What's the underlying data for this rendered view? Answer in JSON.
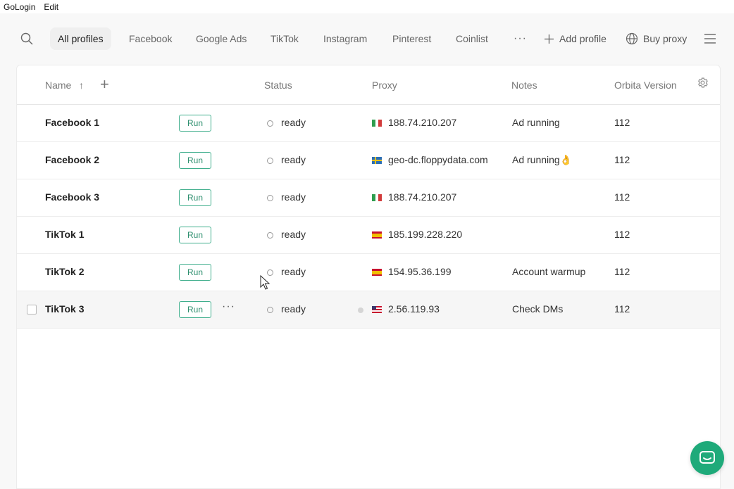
{
  "menubar": {
    "app": "GoLogin",
    "edit": "Edit"
  },
  "tabs": [
    {
      "label": "All profiles"
    },
    {
      "label": "Facebook"
    },
    {
      "label": "Google Ads"
    },
    {
      "label": "TikTok"
    },
    {
      "label": "Instagram"
    },
    {
      "label": "Pinterest"
    },
    {
      "label": "Coinlist"
    }
  ],
  "actions": {
    "more": "···",
    "add_profile": "Add profile",
    "buy_proxy": "Buy proxy"
  },
  "table": {
    "columns": {
      "name": "Name",
      "sort_arrow": "↑",
      "add": "+",
      "status": "Status",
      "proxy": "Proxy",
      "notes": "Notes",
      "version": "Orbita Version"
    },
    "run_label": "Run",
    "row_more": "···",
    "rows": [
      {
        "name": "Facebook 1",
        "status": "ready",
        "proxy": "188.74.210.207",
        "flag": "it",
        "notes": "Ad running",
        "version": "112"
      },
      {
        "name": "Facebook 2",
        "status": "ready",
        "proxy": "geo-dc.floppydata.com",
        "flag": "se",
        "notes": "Ad running👌",
        "version": "112"
      },
      {
        "name": "Facebook 3",
        "status": "ready",
        "proxy": "188.74.210.207",
        "flag": "it",
        "notes": "",
        "version": "112"
      },
      {
        "name": "TikTok 1",
        "status": "ready",
        "proxy": "185.199.228.220",
        "flag": "es",
        "notes": "",
        "version": "112"
      },
      {
        "name": "TikTok 2",
        "status": "ready",
        "proxy": "154.95.36.199",
        "flag": "es",
        "notes": "Account warmup",
        "version": "112"
      },
      {
        "name": "TikTok 3",
        "status": "ready",
        "proxy": "2.56.119.93",
        "flag": "us",
        "notes": "Check DMs",
        "version": "112"
      }
    ]
  },
  "colors": {
    "accent": "#1faa7a",
    "run_border": "#3fae8c"
  },
  "icons": {
    "search": "search-icon",
    "globe": "globe-icon",
    "plus": "plus-icon",
    "menu": "hamburger-icon",
    "settings": "gear-icon",
    "chat": "chat-icon"
  }
}
